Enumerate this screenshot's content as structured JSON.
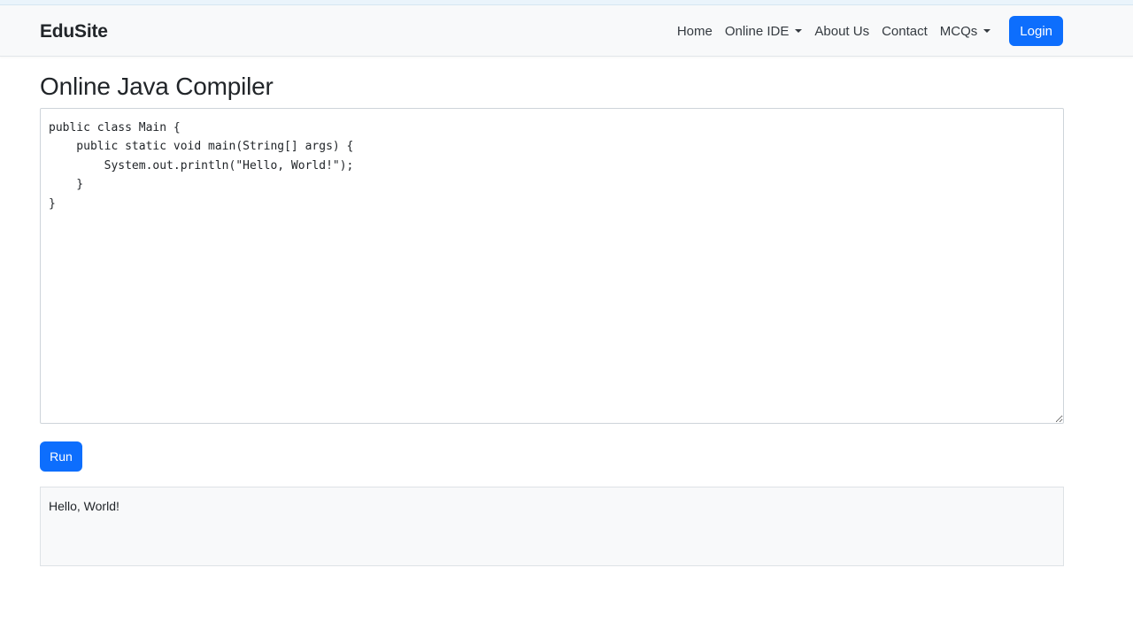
{
  "navbar": {
    "brand": "EduSite",
    "links": [
      {
        "label": "Home"
      },
      {
        "label": "Online IDE",
        "dropdown": true
      },
      {
        "label": "About Us"
      },
      {
        "label": "Contact"
      },
      {
        "label": "MCQs",
        "dropdown": true
      }
    ],
    "login_label": "Login"
  },
  "main": {
    "title": "Online Java Compiler",
    "code": "public class Main {\n    public static void main(String[] args) {\n        System.out.println(\"Hello, World!\");\n    }\n}",
    "run_label": "Run",
    "output": "Hello, World!"
  },
  "colors": {
    "primary": "#0d6efd",
    "navbar_bg": "#f8f9fa",
    "output_bg": "#f8f9fa",
    "text": "#212529"
  }
}
